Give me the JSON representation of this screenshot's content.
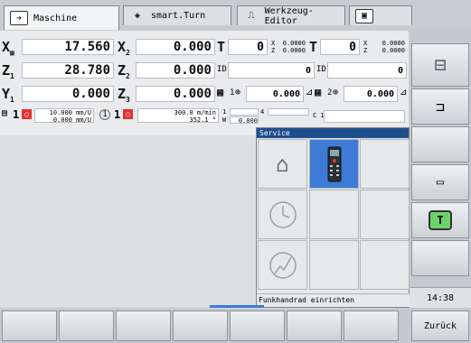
{
  "tabs": [
    {
      "label": "Maschine",
      "icon": "arrow-right-icon"
    },
    {
      "label": "smart.Turn",
      "icon": "diamond-arrow-icon"
    },
    {
      "label": "Werkzeug-Editor",
      "icon": "tool-icon"
    },
    {
      "label": "",
      "icon": "disk-icon"
    }
  ],
  "positions": {
    "x_label": "X",
    "x_value": "17.560",
    "x2_label": "X",
    "x2_value": "0.000",
    "z1_label": "Z",
    "z1_value": "28.780",
    "z2_label": "Z",
    "z2_value": "0.000",
    "y1_label": "Y",
    "y1_value": "0.000",
    "z3_label": "Z",
    "z3_value": "0.000",
    "t_label": "T",
    "t_value": "0",
    "t_x": "0.0000",
    "t_z": "0.0000",
    "t2_label": "T",
    "t2_value": "0",
    "t2_x": "0.0000",
    "t2_z": "0.0000",
    "id_label": "ID",
    "id_value": "0",
    "id2_label": "ID",
    "id2_value": "0",
    "sp1_label": "1",
    "sp1_value": "0.000",
    "sp2_label": "2",
    "sp2_value": "0.000"
  },
  "feed": {
    "s_label": "S1",
    "spindle_num": "1",
    "feed1": "10.000 mm/U",
    "feed2": "0.000 mm/U",
    "unit_label": "1",
    "spindle2_num": "1",
    "speed1": "300.0 m/min",
    "speed2": "352.1 °",
    "field_a_label": "1",
    "field_b_label": "4",
    "field_w_label": "W 1",
    "field_w_value": "0.000",
    "c_label": "C 1"
  },
  "service": {
    "title": "Service",
    "status": "Funkhandrad einrichten"
  },
  "time": "14:38",
  "bottom_keys": [
    "",
    "",
    "",
    "",
    "",
    "",
    "",
    "Zurück"
  ]
}
